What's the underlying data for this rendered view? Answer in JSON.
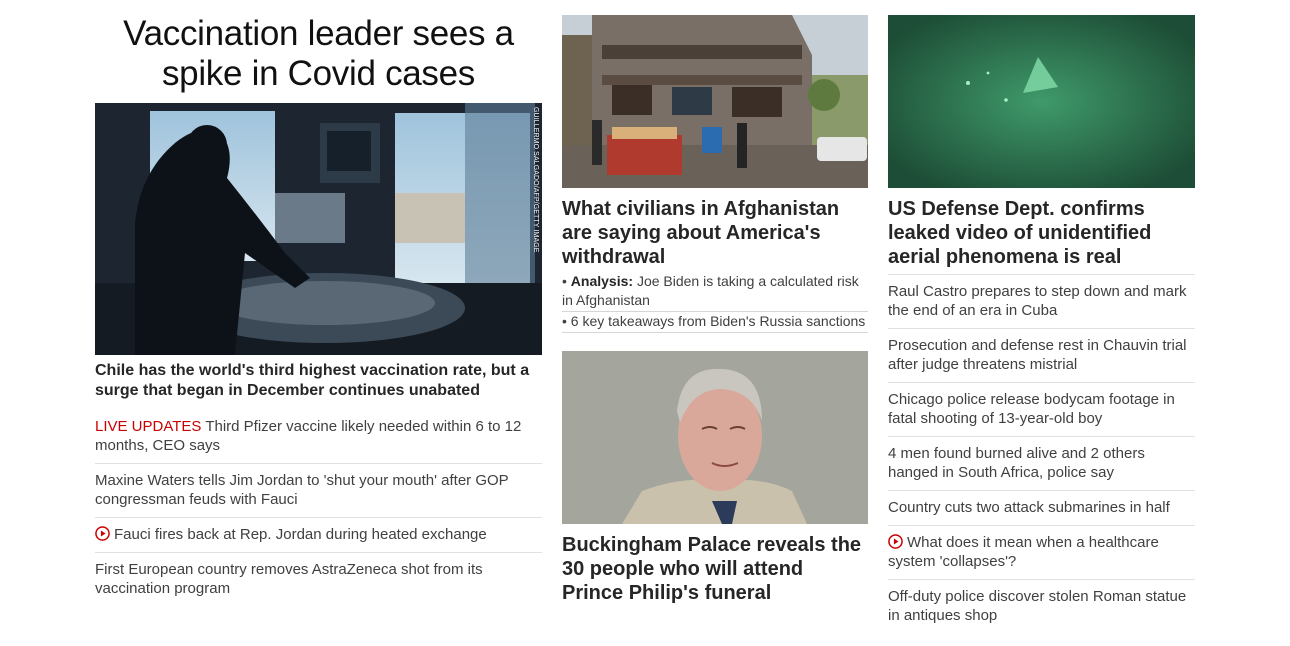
{
  "col1": {
    "headline": "Vaccination leader sees a spike in Covid cases",
    "image_credit": "GUILLERMO SALGADO/AFP/GETTY IMAGES",
    "lead_title": "Chile has the world's third highest vaccination rate, but a surge that began in December continues unabated",
    "items": [
      {
        "tag": "LIVE UPDATES",
        "text": "Third Pfizer vaccine likely needed within 6 to 12 months, CEO says"
      },
      {
        "text": "Maxine Waters tells Jim Jordan to 'shut your mouth' after GOP congressman feuds with Fauci"
      },
      {
        "icon": "play-icon",
        "text": "Fauci fires back at Rep. Jordan during heated exchange"
      },
      {
        "text": "First European country removes AstraZeneca shot from its vaccination program"
      }
    ]
  },
  "col2": {
    "story1": {
      "title": "What civilians in Afghanistan are saying about America's withdrawal",
      "subs": [
        {
          "prefix": "Analysis:",
          "text": "Joe Biden is taking a calculated risk in Afghanistan"
        },
        {
          "text": "6 key takeaways from Biden's Russia sanctions"
        }
      ]
    },
    "story2": {
      "title": "Buckingham Palace reveals the 30 people who will attend Prince Philip's funeral"
    }
  },
  "col3": {
    "title": "US Defense Dept. confirms leaked video of unidentified aerial phenomena is real",
    "items": [
      {
        "text": "Raul Castro prepares to step down and mark the end of an era in Cuba"
      },
      {
        "text": "Prosecution and defense rest in Chauvin trial after judge threatens mistrial"
      },
      {
        "text": "Chicago police release bodycam footage in fatal shooting of 13-year-old boy"
      },
      {
        "text": "4 men found burned alive and 2 others hanged in South Africa, police say"
      },
      {
        "text": "Country cuts two attack submarines in half"
      },
      {
        "icon": "play-icon",
        "text": "What does it mean when a healthcare system 'collapses'?"
      },
      {
        "text": "Off-duty police discover stolen Roman statue in antiques shop"
      }
    ]
  },
  "colors": {
    "live": "#cc0000",
    "text": "#262626",
    "divider": "#e1e1e1"
  }
}
